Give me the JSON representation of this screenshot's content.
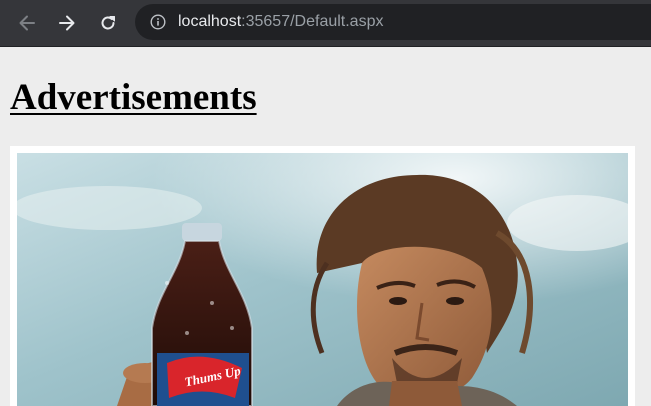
{
  "browser": {
    "url_host": "localhost",
    "url_rest": ":35657/Default.aspx",
    "icons": [
      "back-arrow-icon",
      "forward-arrow-icon",
      "reload-icon",
      "info-icon"
    ]
  },
  "page": {
    "title": "Advertisements"
  },
  "advertisement": {
    "bottle_label": "Thums Up"
  },
  "colors": {
    "browser_bar": "#35363a",
    "address_bar": "#202124",
    "page_background": "#ededed",
    "bottle_label_red": "#d9252b"
  }
}
